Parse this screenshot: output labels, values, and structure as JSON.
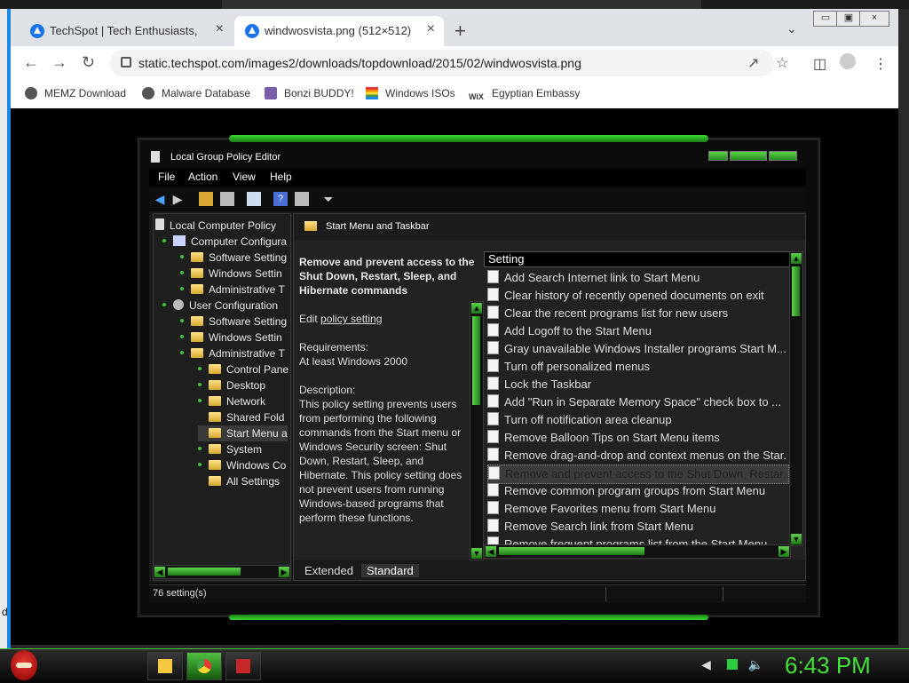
{
  "browser": {
    "tabs": [
      {
        "title": "TechSpot | Tech Enthusiasts, Pow",
        "close": "×"
      },
      {
        "title": "windwosvista.png (512×512)",
        "close": "×"
      }
    ],
    "new_tab": "+",
    "tab_menu": "⌄",
    "window_buttons": {
      "minimize": "▭",
      "restore": "▣",
      "close": "×"
    },
    "url": "static.techspot.com/images2/downloads/topdownload/2015/02/windwosvista.png",
    "bookmarks": [
      "MEMZ Download",
      "Malware Database",
      "Bonzi BUDDY!",
      "Windows ISOs",
      "Egyptian Embassy"
    ]
  },
  "gp": {
    "title": "Local Group Policy Editor",
    "menu": [
      "File",
      "Action",
      "View",
      "Help"
    ],
    "tree": [
      {
        "label": "Local Computer Policy",
        "indent": 0,
        "icon": "doc"
      },
      {
        "label": "Computer Configura",
        "indent": 1,
        "icon": "pc"
      },
      {
        "label": "Software Setting",
        "indent": 2,
        "icon": "folder"
      },
      {
        "label": "Windows Settin",
        "indent": 2,
        "icon": "folder"
      },
      {
        "label": "Administrative T",
        "indent": 2,
        "icon": "folder"
      },
      {
        "label": "User Configuration",
        "indent": 1,
        "icon": "user"
      },
      {
        "label": "Software Setting",
        "indent": 2,
        "icon": "folder"
      },
      {
        "label": "Windows Settin",
        "indent": 2,
        "icon": "folder"
      },
      {
        "label": "Administrative T",
        "indent": 2,
        "icon": "folder"
      },
      {
        "label": "Control Pane",
        "indent": 3,
        "icon": "folder"
      },
      {
        "label": "Desktop",
        "indent": 3,
        "icon": "folder"
      },
      {
        "label": "Network",
        "indent": 3,
        "icon": "folder"
      },
      {
        "label": "Shared Fold",
        "indent": 3,
        "icon": "folder"
      },
      {
        "label": "Start Menu a",
        "indent": 3,
        "icon": "folder"
      },
      {
        "label": "System",
        "indent": 3,
        "icon": "folder"
      },
      {
        "label": "Windows Co",
        "indent": 3,
        "icon": "folder"
      },
      {
        "label": "All Settings",
        "indent": 3,
        "icon": "folder"
      }
    ],
    "right_title": "Start Menu and Taskbar",
    "desc_heading": "Remove and prevent access to the Shut Down, Restart, Sleep, and Hibernate commands",
    "edit_prefix": "Edit",
    "edit_link": "policy setting",
    "requirements_label": "Requirements:",
    "requirements_value": "At least Windows 2000",
    "description_label": "Description:",
    "description": "This policy setting prevents users from performing the following commands from the Start menu or Windows Security screen: Shut Down, Restart, Sleep, and Hibernate. This policy setting does not prevent users from running Windows-based programs that perform these functions.",
    "list_header": "Setting",
    "settings": [
      "Add Search Internet link to Start Menu",
      "Clear history of recently opened documents on exit",
      "Clear the recent programs list for new users",
      "Add Logoff to the Start Menu",
      "Gray unavailable Windows Installer programs Start M...",
      "Turn off personalized menus",
      "Lock the Taskbar",
      "Add \"Run in Separate Memory Space\" check box to ...",
      "Turn off notification area cleanup",
      "Remove Balloon Tips on Start Menu items",
      "Remove drag-and-drop and context menus on the Star...",
      "Remove and prevent access to the Shut Down, Restar...",
      "Remove common program groups from Start Menu",
      "Remove Favorites menu from Start Menu",
      "Remove Search link from Start Menu",
      "Remove frequent programs list from the Start Menu"
    ],
    "view_tabs": [
      "Extended",
      "Standard"
    ],
    "status": "76 setting(s)"
  },
  "taskbar": {
    "clock": "6:43 PM"
  },
  "left_fragment": "d"
}
